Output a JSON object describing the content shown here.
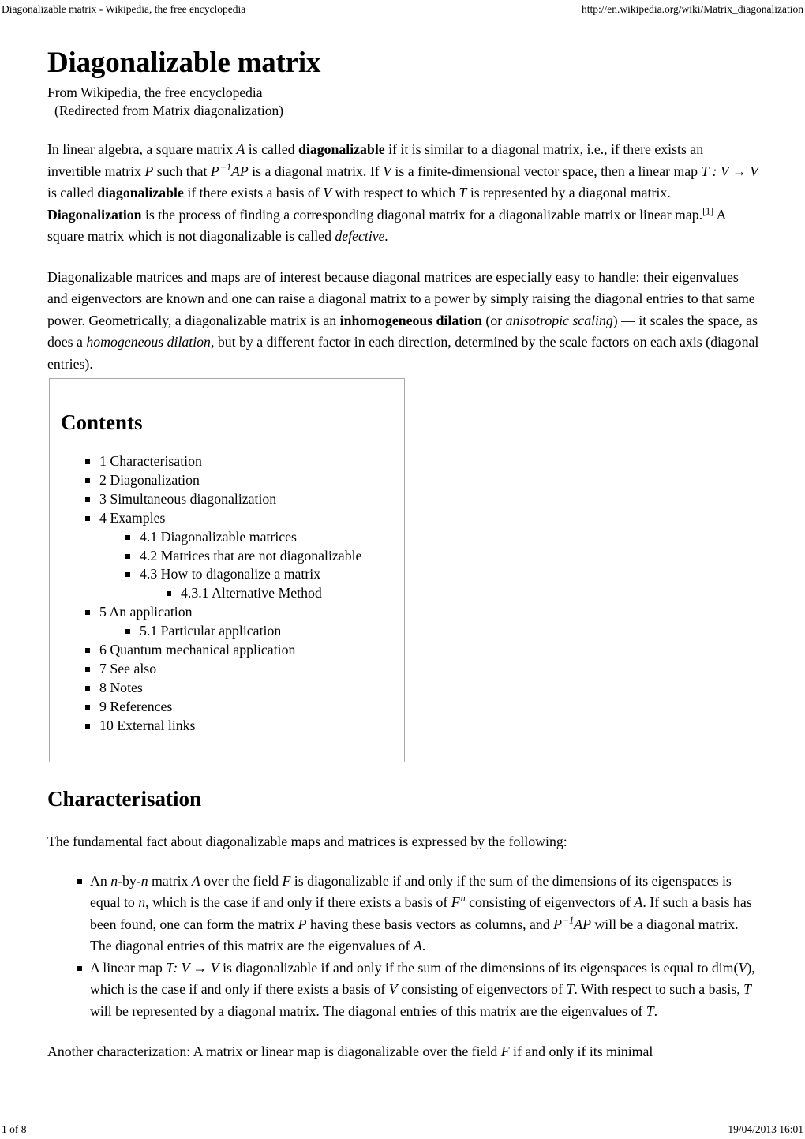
{
  "header": {
    "title": "Diagonalizable matrix - Wikipedia, the free encyclopedia",
    "url": "http://en.wikipedia.org/wiki/Matrix_diagonalization"
  },
  "footer": {
    "page_number": "1 of 8",
    "timestamp": "19/04/2013 16:01"
  },
  "article": {
    "title": "Diagonalizable matrix",
    "subtitle": "From Wikipedia, the free encyclopedia",
    "redirect_note": "(Redirected from Matrix diagonalization)",
    "paragraph1": {
      "s1": "In linear algebra, a square matrix ",
      "v1": "A",
      "s2": " is called ",
      "b1": "diagonalizable",
      "s3": " if it is similar to a diagonal matrix, i.e., if there exists an invertible matrix ",
      "v2": "P",
      "s4": " such that ",
      "m1_base": "P",
      "m1_exp": "−1",
      "m1_tail": "AP",
      "s5": " is a diagonal matrix. If ",
      "v3": "V",
      "s6": " is a finite-dimensional vector space, then a linear map ",
      "m2": "T : V → V",
      "s7": " is called ",
      "b2": "diagonalizable",
      "s8": " if there exists a basis of ",
      "v4": "V",
      "s9": " with respect to which ",
      "v5": "T",
      "s10": " is represented by a diagonal matrix. ",
      "b3": "Diagonalization",
      "s11": " is the process of finding a corresponding diagonal matrix for a diagonalizable matrix or linear map.",
      "ref1": "[1]",
      "s12": " A square matrix which is not diagonalizable is called ",
      "i1": "defective.",
      "s13": ""
    },
    "paragraph2": {
      "s1": "Diagonalizable matrices and maps are of interest because diagonal matrices are especially easy to handle: their eigenvalues and eigenvectors are known and one can raise a diagonal matrix to a power by simply raising the diagonal entries to that same power. Geometrically, a diagonalizable matrix is an ",
      "b1": "inhomogeneous dilation",
      "s2": " (or ",
      "i1": "anisotropic scaling",
      "s3": ") — it scales the space, as does a ",
      "i2": "homogeneous dilation",
      "s4": ", but by a different factor in each direction, determined by the scale factors on each axis (diagonal entries)."
    }
  },
  "toc": {
    "title": "Contents",
    "items": [
      {
        "level": 1,
        "label": "1 Characterisation"
      },
      {
        "level": 1,
        "label": "2 Diagonalization"
      },
      {
        "level": 1,
        "label": "3 Simultaneous diagonalization"
      },
      {
        "level": 1,
        "label": "4 Examples"
      },
      {
        "level": 2,
        "label": "4.1 Diagonalizable matrices"
      },
      {
        "level": 2,
        "label": "4.2 Matrices that are not diagonalizable"
      },
      {
        "level": 2,
        "label": "4.3 How to diagonalize a matrix"
      },
      {
        "level": 3,
        "label": "4.3.1 Alternative Method"
      },
      {
        "level": 1,
        "label": "5 An application"
      },
      {
        "level": 2,
        "label": "5.1 Particular application"
      },
      {
        "level": 1,
        "label": "6 Quantum mechanical application"
      },
      {
        "level": 1,
        "label": "7 See also"
      },
      {
        "level": 1,
        "label": "8 Notes"
      },
      {
        "level": 1,
        "label": "9 References"
      },
      {
        "level": 1,
        "label": "10 External links"
      }
    ]
  },
  "characterisation": {
    "heading": "Characterisation",
    "intro": "The fundamental fact about diagonalizable maps and matrices is expressed by the following:",
    "bullet1": {
      "s1": "An ",
      "v1": "n",
      "s2": "-by-",
      "v2": "n",
      "s3": " matrix ",
      "v3": "A",
      "s4": " over the field ",
      "v4": "F",
      "s5": " is diagonalizable if and only if the sum of the dimensions of its eigenspaces is equal to ",
      "v5": "n",
      "s6": ", which is the case if and only if there exists a basis of ",
      "m1_base": "F",
      "m1_exp": "n",
      "s7": " consisting of eigenvectors of ",
      "v6": "A",
      "s8": ". If such a basis has been found, one can form the matrix ",
      "v7": "P",
      "s9": " having these basis vectors as columns, and ",
      "m2_base": "P",
      "m2_exp": "−1",
      "m2_tail": "AP",
      "s10": " will be a diagonal matrix. The diagonal entries of this matrix are the eigenvalues of ",
      "v8": "A",
      "s11": "."
    },
    "bullet2": {
      "s1": "A linear map ",
      "m1": "T: V → V",
      "s2": " is diagonalizable if and only if the sum of the dimensions of its eigenspaces is equal to dim(",
      "v1": "V",
      "s3": "), which is the case if and only if there exists a basis of ",
      "v2": "V",
      "s4": " consisting of eigenvectors of ",
      "v3": "T",
      "s5": ". With respect to such a basis, ",
      "v4": "T",
      "s6": " will be represented by a diagonal matrix. The diagonal entries of this matrix are the eigenvalues of ",
      "v5": "T",
      "s7": "."
    },
    "closing": {
      "s1": "Another characterization: A matrix or linear map is diagonalizable over the field ",
      "v1": "F",
      "s2": " if and only if its minimal"
    }
  }
}
